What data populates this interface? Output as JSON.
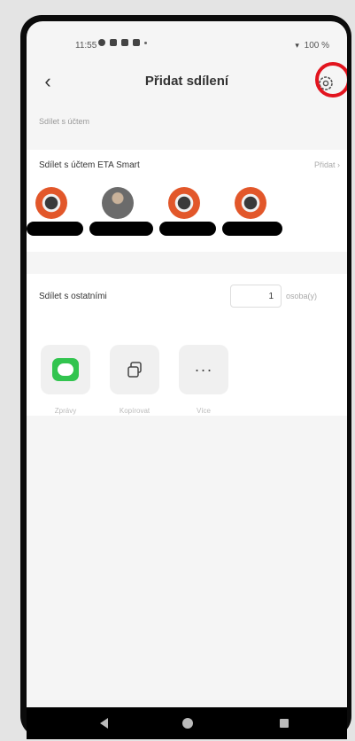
{
  "status_bar": {
    "time": "11:55",
    "battery": "100 %"
  },
  "header": {
    "title": "Přidat sdílení",
    "back_icon": "chevron-left-icon",
    "settings_icon": "gear-icon",
    "highlight_color": "#e2141e"
  },
  "share_account_section": {
    "label": "Sdílet s účtem",
    "heading": "Sdílet s účtem ETA Smart",
    "add_label": "Přidat",
    "avatars": [
      {
        "kind": "device-avatar"
      },
      {
        "kind": "photo-avatar"
      },
      {
        "kind": "device-avatar"
      },
      {
        "kind": "device-avatar"
      }
    ]
  },
  "share_others_section": {
    "heading": "Sdílet s ostatními",
    "count_value": "1",
    "unit": "osoba(y)",
    "apps": [
      {
        "label": "Zprávy",
        "icon": "message-icon"
      },
      {
        "label": "Kopírovat",
        "icon": "copy-icon"
      },
      {
        "label": "Více",
        "icon": "more-icon"
      }
    ]
  },
  "colors": {
    "accent_green": "#32c44f",
    "avatar_orange": "#e2572a"
  }
}
